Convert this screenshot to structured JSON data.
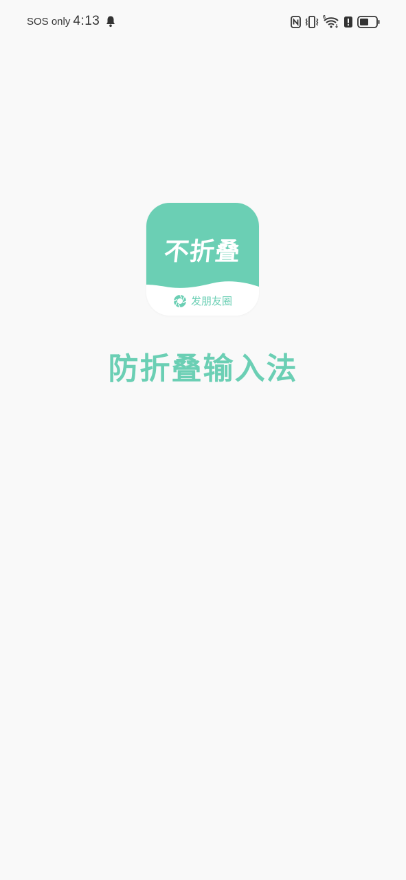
{
  "status_bar": {
    "carrier": "SOS only",
    "time": "4:13",
    "icons": [
      "bell-icon",
      "nfc-icon",
      "vibrate-icon",
      "wifi-6-icon",
      "alert-icon",
      "battery-icon"
    ],
    "wifi_badge": "6"
  },
  "splash": {
    "app_icon": {
      "title": "不折叠",
      "subtitle": "发朋友圈",
      "icon": "camera-shutter-icon"
    },
    "app_name": "防折叠输入法"
  },
  "colors": {
    "accent": "#6bcfb4",
    "background": "#f9f9f9",
    "status_text": "#333333"
  }
}
